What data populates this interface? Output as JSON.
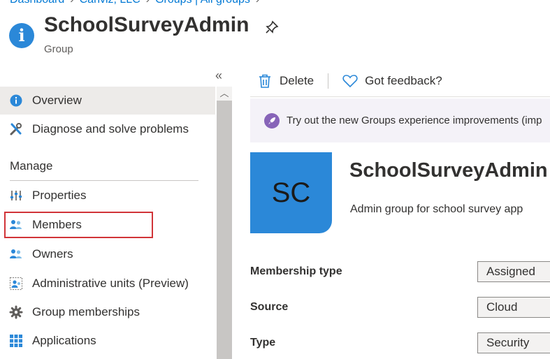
{
  "breadcrumbs": [
    "Dashboard",
    "Canviz, LLC",
    "Groups | All groups"
  ],
  "page": {
    "title": "SchoolSurveyAdmin",
    "subtitle": "Group"
  },
  "sidebar": {
    "collapse_glyph": "«",
    "items": [
      {
        "label": "Overview",
        "icon": "info-icon",
        "active": true
      },
      {
        "label": "Diagnose and solve problems",
        "icon": "wrench-icon"
      }
    ],
    "section_title": "Manage",
    "manage_items": [
      {
        "label": "Properties",
        "icon": "properties-icon"
      },
      {
        "label": "Members",
        "icon": "members-icon",
        "highlighted": true
      },
      {
        "label": "Owners",
        "icon": "owners-icon"
      },
      {
        "label": "Administrative units (Preview)",
        "icon": "admin-units-icon"
      },
      {
        "label": "Group memberships",
        "icon": "gear-icon"
      },
      {
        "label": "Applications",
        "icon": "applications-icon"
      }
    ]
  },
  "toolbar": {
    "delete_label": "Delete",
    "feedback_label": "Got feedback?"
  },
  "banner": {
    "text": "Try out the new Groups experience improvements (imp"
  },
  "group": {
    "initials": "SC",
    "name": "SchoolSurveyAdmin",
    "description": "Admin group for school survey app"
  },
  "properties": [
    {
      "label": "Membership type",
      "value": "Assigned"
    },
    {
      "label": "Source",
      "value": "Cloud"
    },
    {
      "label": "Type",
      "value": "Security"
    }
  ],
  "colors": {
    "accent": "#0078d4",
    "avatar": "#2b88d8",
    "highlight_border": "#d13438",
    "banner_icon": "#8764b8"
  }
}
